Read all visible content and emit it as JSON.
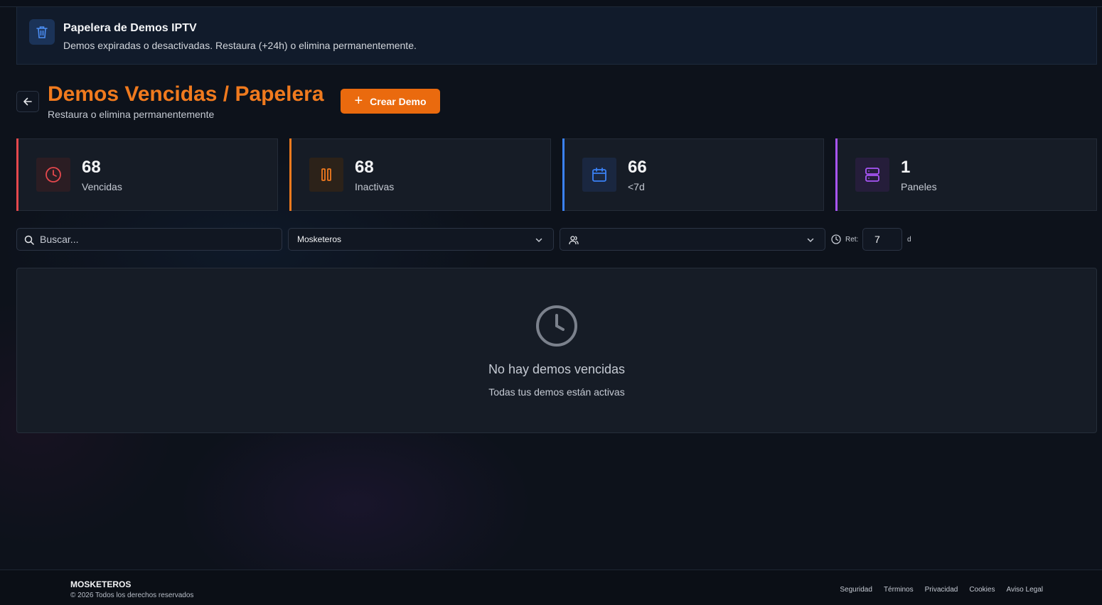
{
  "banner": {
    "title": "Papelera de Demos IPTV",
    "subtitle": "Demos expiradas o desactivadas. Restaura (+24h) o elimina permanentemente.",
    "icon": "trash-icon"
  },
  "header": {
    "title": "Demos Vencidas / Papelera",
    "subtitle": "Restaura o elimina permanentemente",
    "create_label": "Crear Demo"
  },
  "stats": [
    {
      "value": "68",
      "label": "Vencidas",
      "icon": "clock-icon",
      "color": "#e5484d"
    },
    {
      "value": "68",
      "label": "Inactivas",
      "icon": "pause-icon",
      "color": "#f07a1e"
    },
    {
      "value": "66",
      "label": "<7d",
      "icon": "calendar-icon",
      "color": "#3b82f6"
    },
    {
      "value": "1",
      "label": "Paneles",
      "icon": "server-icon",
      "color": "#a855f7"
    }
  ],
  "filters": {
    "search_placeholder": "Buscar...",
    "panel_select": "Mosketeros",
    "user_select": "",
    "retention_label": "Ret:",
    "retention_value": "7",
    "retention_unit": "d"
  },
  "empty_state": {
    "title": "No hay demos vencidas",
    "message": "Todas tus demos están activas"
  },
  "footer": {
    "brand": "MOSKETEROS",
    "copyright": "© 2026 Todos los derechos reservados",
    "links": [
      "Seguridad",
      "Términos",
      "Privacidad",
      "Cookies",
      "Aviso Legal"
    ]
  }
}
